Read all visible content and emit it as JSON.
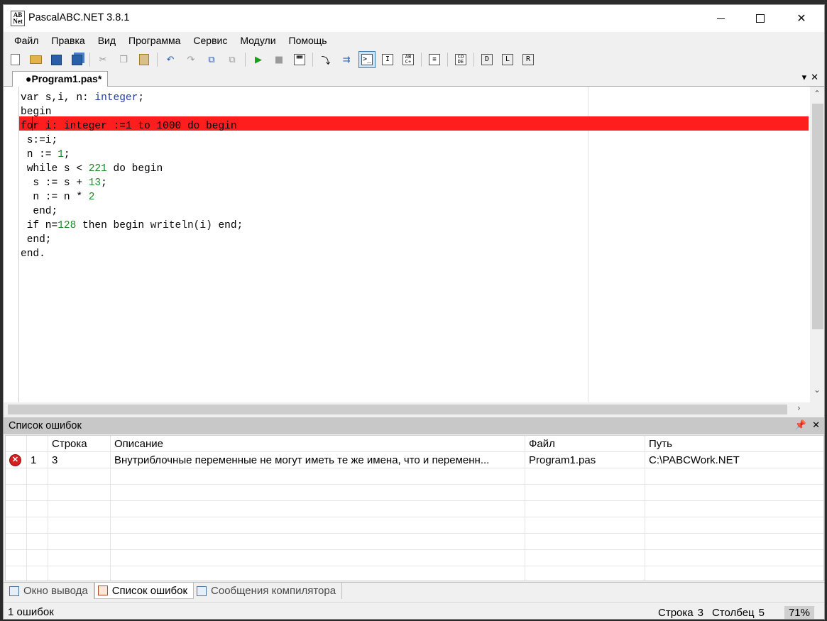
{
  "window": {
    "title": "PascalABC.NET 3.8.1",
    "icon_text": "AB\nNet"
  },
  "menu": [
    "Файл",
    "Правка",
    "Вид",
    "Программа",
    "Сервис",
    "Модули",
    "Помощь"
  ],
  "toolbar": [
    "new-file-icon",
    "open-file-icon",
    "save-icon",
    "save-all-icon",
    "cut-icon",
    "copy-icon",
    "paste-icon",
    "undo-icon",
    "redo-icon",
    "find-icon",
    "replace-icon",
    "run-icon",
    "stop-icon",
    "compile-icon",
    "step-into-icon",
    "step-over-icon",
    "console-icon",
    "format-icon",
    "spell-icon",
    "navigate-icon",
    "code-icon",
    "debug-d-icon",
    "debug-l-icon",
    "debug-r-icon"
  ],
  "editor": {
    "tab_label": "●Program1.pas*",
    "lines": [
      [
        {
          "t": "var s,i, n: ",
          "c": "kw"
        },
        {
          "t": "integer",
          "c": "ty"
        },
        {
          "t": ";",
          "c": "kw"
        }
      ],
      [
        {
          "t": "begin",
          "c": "kw"
        }
      ],
      [
        {
          "t": "for i: integer :=1 to 1000 do begin",
          "c": "hl"
        }
      ],
      [
        {
          "t": " s:=i;",
          "c": "kw"
        }
      ],
      [
        {
          "t": " n := ",
          "c": "kw"
        },
        {
          "t": "1",
          "c": "nm"
        },
        {
          "t": ";",
          "c": "kw"
        }
      ],
      [
        {
          "t": " while s < ",
          "c": "kw"
        },
        {
          "t": "221",
          "c": "nm"
        },
        {
          "t": " do begin",
          "c": "kw"
        }
      ],
      [
        {
          "t": "  s := s + ",
          "c": "kw"
        },
        {
          "t": "13",
          "c": "nm"
        },
        {
          "t": ";",
          "c": "kw"
        }
      ],
      [
        {
          "t": "  n := n * ",
          "c": "kw"
        },
        {
          "t": "2",
          "c": "nm"
        }
      ],
      [
        {
          "t": "  end;",
          "c": "kw"
        }
      ],
      [
        {
          "t": " if n=",
          "c": "kw"
        },
        {
          "t": "128",
          "c": "nm"
        },
        {
          "t": " then begin ",
          "c": "kw"
        },
        {
          "t": "writeln(i)",
          "c": "fn"
        },
        {
          "t": " end;",
          "c": "kw"
        }
      ],
      [
        {
          "t": " end;",
          "c": "kw"
        }
      ],
      [
        {
          "t": "end.",
          "c": "kw"
        }
      ]
    ]
  },
  "errors_panel": {
    "title": "Список ошибок",
    "columns": [
      "",
      "",
      "Строка",
      "Описание",
      "Файл",
      "Путь"
    ],
    "rows": [
      {
        "num": "1",
        "line": "3",
        "desc": "Внутриблочные переменные не могут иметь те же имена, что и переменн...",
        "file": "Program1.pas",
        "path": "C:\\PABCWork.NET"
      }
    ]
  },
  "bottom_tabs": [
    "Окно вывода",
    "Список ошибок",
    "Сообщения компилятора"
  ],
  "status": {
    "left": "1 ошибок",
    "row_label": "Строка",
    "row_value": "3",
    "col_label": "Столбец",
    "col_value": "5",
    "zoom": "71%"
  }
}
